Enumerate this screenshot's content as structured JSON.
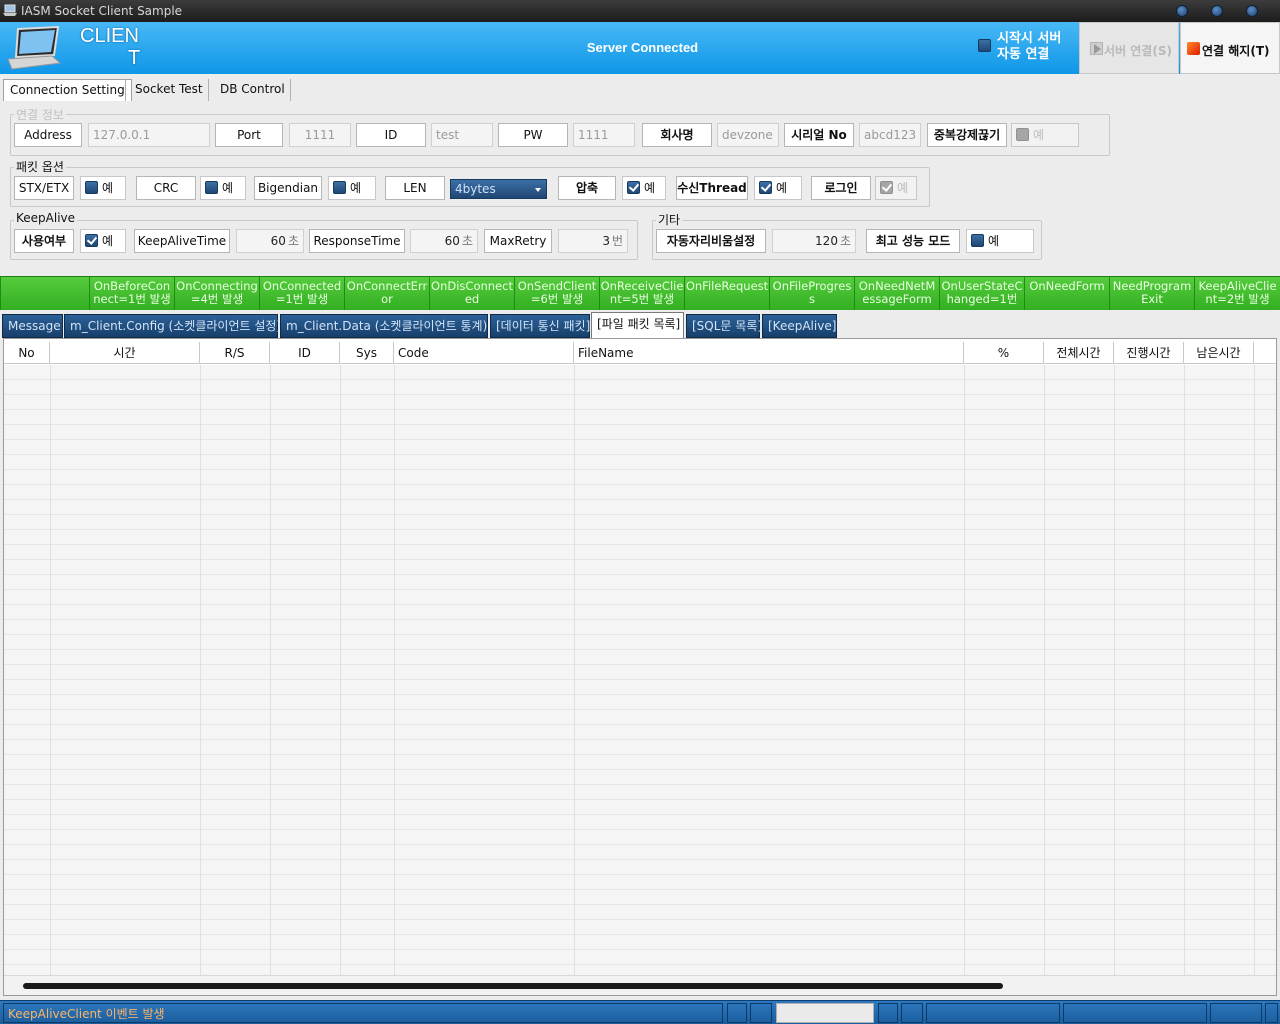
{
  "window": {
    "title": "IASM Socket Client Sample"
  },
  "header": {
    "logo_line1": "CLIEN",
    "logo_line2": "T",
    "status": "Server Connected",
    "auto_connect_label1": "시작시 서버",
    "auto_connect_label2": "자동 연결",
    "connect_button": "서버 연결(S)",
    "disconnect_button": "연결 해지(T)"
  },
  "top_tabs": [
    "Connection Setting",
    "Socket Test",
    "DB Control"
  ],
  "connection": {
    "title": "연결 정보",
    "address_label": "Address",
    "address_value": "127.0.0.1",
    "port_label": "Port",
    "port_value": "1111",
    "id_label": "ID",
    "id_value": "test",
    "pw_label": "PW",
    "pw_value": "1111",
    "company_label": "회사명",
    "company_value": "devzone",
    "serial_label": "시리얼 No",
    "serial_value": "abcd123",
    "dup_label": "중복강제끊기",
    "dup_check": "예"
  },
  "packet": {
    "title": "패킷 옵션",
    "stx_label": "STX/ETX",
    "stx_check": "예",
    "crc_label": "CRC",
    "crc_check": "예",
    "bigendian_label": "Bigendian",
    "bigendian_check": "예",
    "len_label": "LEN",
    "len_value": "4bytes",
    "compress_label": "압축",
    "compress_check": "예",
    "recv_label": "수신Thread",
    "recv_check": "예",
    "login_label": "로그인",
    "login_check": "예"
  },
  "keepalive": {
    "title": "KeepAlive",
    "use_label": "사용여부",
    "use_check": "예",
    "time_label": "KeepAliveTime",
    "time_value": "60",
    "time_unit": "초",
    "resp_label": "ResponseTime",
    "resp_value": "60",
    "resp_unit": "초",
    "retry_label": "MaxRetry",
    "retry_value": "3",
    "retry_unit": "번"
  },
  "etc": {
    "title": "기타",
    "auto_label": "자동자리비움설정",
    "auto_value": "120",
    "auto_unit": "초",
    "perf_label": "최고 성능 모드",
    "perf_check": "예"
  },
  "events": [
    {
      "l1": "",
      "l2": ""
    },
    {
      "l1": "OnBeforeCon",
      "l2": "nect=1번 발생"
    },
    {
      "l1": "OnConnecting",
      "l2": "=4번 발생"
    },
    {
      "l1": "OnConnected",
      "l2": "=1번 발생"
    },
    {
      "l1": "OnConnectErr",
      "l2": "or"
    },
    {
      "l1": "OnDisConnect",
      "l2": "ed"
    },
    {
      "l1": "OnSendClient",
      "l2": "=6번 발생"
    },
    {
      "l1": "OnReceiveClie",
      "l2": "nt=5번 발생"
    },
    {
      "l1": "OnFileRequest",
      "l2": ""
    },
    {
      "l1": "OnFileProgres",
      "l2": "s"
    },
    {
      "l1": "OnNeedNetM",
      "l2": "essageForm"
    },
    {
      "l1": "OnUserStateC",
      "l2": "hanged=1번"
    },
    {
      "l1": "OnNeedForm",
      "l2": ""
    },
    {
      "l1": "NeedProgram",
      "l2": "Exit"
    },
    {
      "l1": "KeepAliveClie",
      "l2": "nt=2번 발생"
    }
  ],
  "bottom_tabs": [
    "Message",
    "m_Client.Config (소켓클라이언트 설정)",
    "m_Client.Data (소켓클라이언트 통계)",
    "[데이터 통신 패킷]",
    "[파일 패킷 목록]",
    "[SQL문 목록]",
    "[KeepAlive]"
  ],
  "grid": {
    "columns": [
      "No",
      "시간",
      "R/S",
      "ID",
      "Sys",
      "Code",
      "FileName",
      "%",
      "전체시간",
      "진행시간",
      "남은시간"
    ]
  },
  "statusbar": {
    "message": "KeepAliveClient 이벤트 발생"
  },
  "colors": {
    "header_blue": "#1aa0ee",
    "event_green": "#3cbb28",
    "tab_blue": "#1f4f82",
    "status_orange": "#ffb464"
  }
}
